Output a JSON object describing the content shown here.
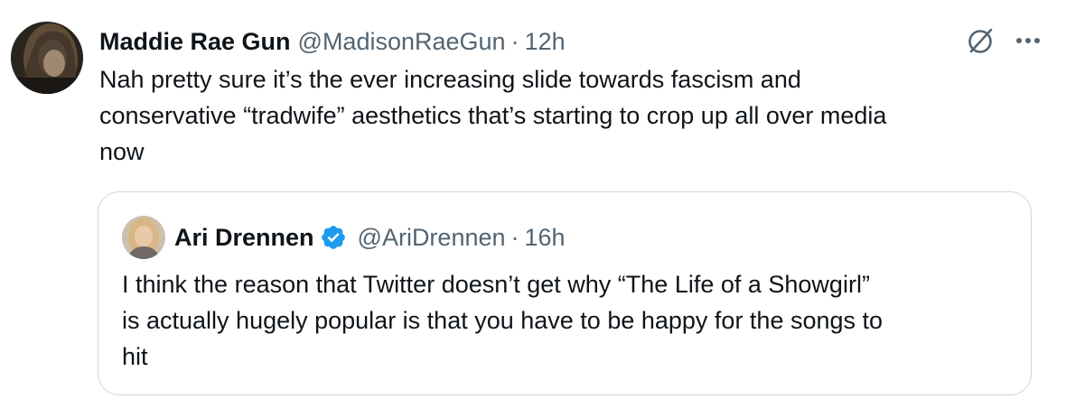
{
  "tweet": {
    "author": {
      "name": "Maddie Rae Gun",
      "handle": "@MadisonRaeGun",
      "avatar_icon": "user-avatar"
    },
    "separator": "·",
    "time": "12h",
    "body_lines": [
      "Nah pretty sure it’s the ever increasing slide towards fascism and",
      "conservative “tradwife” aesthetics that’s starting to crop up all over media",
      "now"
    ],
    "actions": {
      "grok_icon": "grok-icon",
      "more_icon": "more-options-icon"
    }
  },
  "quote": {
    "author": {
      "name": "Ari Drennen",
      "handle": "@AriDrennen",
      "verified": true,
      "verified_icon": "verified-badge-icon"
    },
    "separator": "·",
    "time": "16h",
    "body_lines": [
      "I think the reason that Twitter doesn’t get why “The Life of a Showgirl”",
      "is actually hugely popular is that you have to be happy for the songs to",
      "hit"
    ]
  },
  "colors": {
    "text_primary": "#0f1419",
    "text_secondary": "#536471",
    "border": "#cfd9de",
    "verified_blue": "#1d9bf0"
  }
}
